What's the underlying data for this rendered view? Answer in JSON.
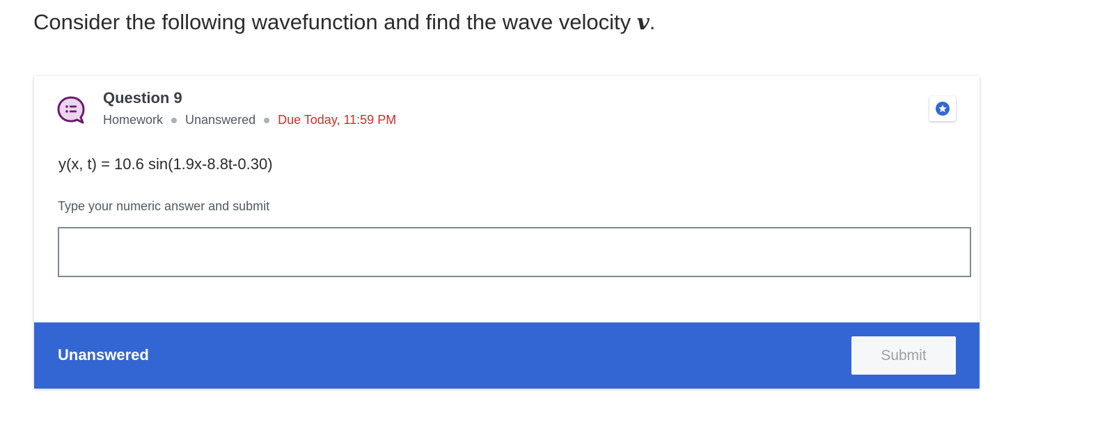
{
  "prompt": {
    "text": "Consider the following wavefunction and find the wave velocity ",
    "variable": "v",
    "suffix": "."
  },
  "question": {
    "icon": "speech-bubble-list-icon",
    "title": "Question 9",
    "type": "Homework",
    "status": "Unanswered",
    "due": "Due Today, 11:59 PM",
    "star_icon": "star-icon",
    "equation": "y(x, t) = 10.6 sin(1.9x-8.8t-0.30)",
    "instruction": "Type your numeric answer and submit",
    "answer_value": "",
    "answer_placeholder": ""
  },
  "footer": {
    "status": "Unanswered",
    "submit_label": "Submit"
  },
  "colors": {
    "accent": "#3466d3",
    "icon_purple": "#6b1a6e",
    "due_red": "#c8302b"
  }
}
